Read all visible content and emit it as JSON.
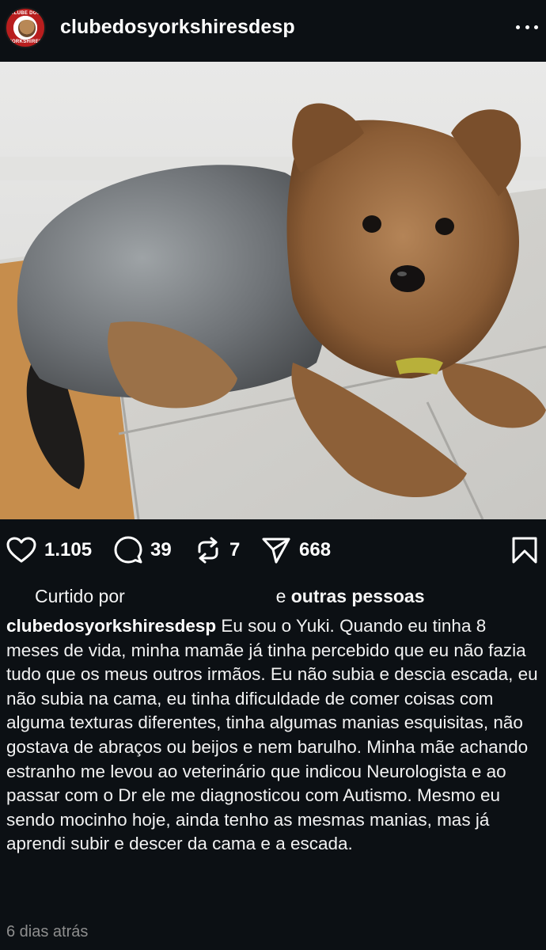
{
  "header": {
    "username": "clubedosyorkshiresdesp",
    "avatar_text_top": "CLUBE DOS",
    "avatar_text_bottom": "YORKSHIRES",
    "more_icon": "more-horizontal-icon"
  },
  "actions": {
    "likes": "1.105",
    "comments": "39",
    "reposts": "7",
    "shares": "668",
    "icons": [
      "heart-icon",
      "comment-icon",
      "repost-icon",
      "share-icon",
      "bookmark-icon"
    ]
  },
  "liked_by": {
    "prefix": "Curtido por",
    "connector": "e",
    "others": "outras pessoas"
  },
  "caption": {
    "username": "clubedosyorkshiresdesp",
    "text": "Eu sou o Yuki. Quando eu tinha 8 meses de vida, minha mamãe já tinha percebido que eu não fazia tudo que os meus outros irmãos. Eu não subia e descia escada, eu não subia na cama, eu tinha dificuldade de comer coisas com alguma texturas diferentes, tinha algumas manias esquisitas, não gostava de abraços ou beijos e nem barulho. Minha mãe achando estranho me levou ao veterinário que indicou Neurologista e ao passar com o Dr ele me diagnosticou com Autismo. Mesmo eu sendo mocinho hoje, ainda tenho as mesmas manias, mas já aprendi subir e descer da cama e a escada."
  },
  "timestamp": "6 dias atrás",
  "colors": {
    "background": "#0c1014",
    "text": "#f5f5f5",
    "muted": "#8e8e8e"
  }
}
